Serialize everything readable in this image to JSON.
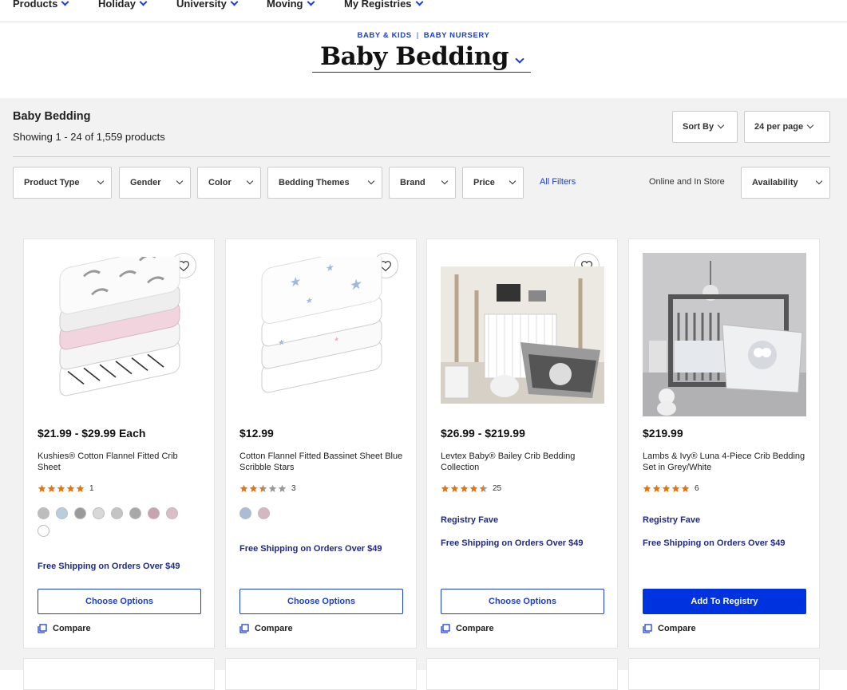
{
  "nav": {
    "items": [
      "Products",
      "Holiday",
      "University",
      "Moving",
      "My Registries"
    ]
  },
  "breadcrumb": [
    "BABY & KIDS",
    "BABY NURSERY"
  ],
  "page_title": "Baby Bedding",
  "results": {
    "title": "Baby Bedding",
    "count": "Showing 1 - 24 of 1,559 products"
  },
  "sort": {
    "sort_label": "Sort By",
    "per_page_label": "24 per page"
  },
  "filters": {
    "items": [
      "Product Type",
      "Gender",
      "Color",
      "Bedding Themes",
      "Brand",
      "Price"
    ],
    "all_filters": "All Filters",
    "online_in_store": "Online and In Store",
    "availability": "Availability"
  },
  "colors": {
    "accent": "#1a3fd6",
    "primary_button": "#0033e0",
    "promo_text": "#1e2a88",
    "star": "#e8730c"
  },
  "products": [
    {
      "price": "$21.99 - $29.99 Each",
      "name": "Kushies® Cotton Flannel Fitted Crib Sheet",
      "rating": 5,
      "reviews": "1",
      "swatches": [
        "#bdbdbd",
        "#b9cde0",
        "#9a9a9a",
        "#d8d8d8",
        "#c4c4c4",
        "#a8a8a8",
        "#c9a3ad",
        "#dcbcc7",
        "#ffffff"
      ],
      "registry_fave": "",
      "shipping": "Free Shipping on Orders Over $49",
      "cta": "Choose Options",
      "compare": "Compare"
    },
    {
      "price": "$12.99",
      "name": "Cotton Flannel Fitted Bassinet Sheet Blue Scribble Stars",
      "rating": 2.5,
      "reviews": "3",
      "swatches": [
        "#a9bed6",
        "#d7b6c2"
      ],
      "registry_fave": "",
      "shipping": "Free Shipping on Orders Over $49",
      "cta": "Choose Options",
      "compare": "Compare"
    },
    {
      "price": "$26.99 - $219.99",
      "name": "Levtex Baby® Bailey Crib Bedding Collection",
      "rating": 4.5,
      "reviews": "25",
      "swatches": [],
      "registry_fave": "Registry Fave",
      "shipping": "Free Shipping on Orders Over $49",
      "cta": "Choose Options",
      "compare": "Compare"
    },
    {
      "price": "$219.99",
      "name": "Lambs & Ivy® Luna 4-Piece Crib Bedding Set in Grey/White",
      "rating": 5,
      "reviews": "6",
      "swatches": [],
      "registry_fave": "Registry Fave",
      "shipping": "Free Shipping on Orders Over $49",
      "cta": "Add To Registry",
      "compare": "Compare"
    }
  ]
}
